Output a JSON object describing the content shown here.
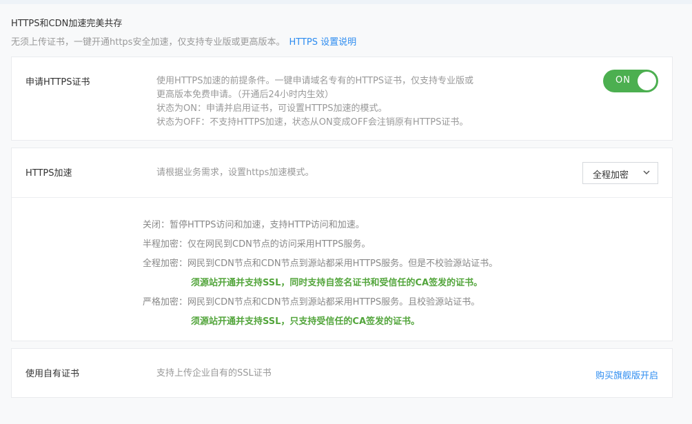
{
  "header": {
    "title": "HTTPS和CDN加速完美共存",
    "subtitle": "无须上传证书，一键开通https安全加速，仅支持专业版或更高版本。",
    "help_link": "HTTPS 设置说明"
  },
  "cert_card": {
    "label": "申请HTTPS证书",
    "desc_lines": [
      "使用HTTPS加速的前提条件。一键申请域名专有的HTTPS证书，仅支持专业版或",
      "更高版本免费申请。（开通后24小时内生效）",
      "状态为ON：申请并启用证书，可设置HTTPS加速的模式。",
      "状态为OFF：不支持HTTPS加速，状态从ON变成OFF会注销原有HTTPS证书。"
    ],
    "toggle": {
      "state": "ON",
      "color": "#4caf50"
    }
  },
  "accel_card": {
    "label": "HTTPS加速",
    "desc": "请根据业务需求，设置https加速模式。",
    "select_value": "全程加密",
    "modes": [
      {
        "text": "关闭：暂停HTTPS访问和加速，支持HTTP访问和加速。"
      },
      {
        "text": "半程加密：仅在网民到CDN节点的访问采用HTTPS服务。"
      },
      {
        "text": "全程加密：网民到CDN节点和CDN节点到源站都采用HTTPS服务。但是不校验源站证书。"
      },
      {
        "note": "须源站开通并支持SSL，同时支持自签名证书和受信任的CA签发的证书。"
      },
      {
        "text": "严格加密：网民到CDN节点和CDN节点到源站都采用HTTPS服务。且校验源站证书。"
      },
      {
        "note": "须源站开通并支持SSL，只支持受信任的CA签发的证书。"
      }
    ],
    "note_color": "#53a53c"
  },
  "own_cert_card": {
    "label": "使用自有证书",
    "desc": "支持上传企业自有的SSL证书",
    "link": "购买旗舰版开启"
  },
  "colors": {
    "link": "#2d8cf0",
    "accent": "#4caf50"
  },
  "icons": {
    "select_arrow": "chevron-down-icon"
  }
}
